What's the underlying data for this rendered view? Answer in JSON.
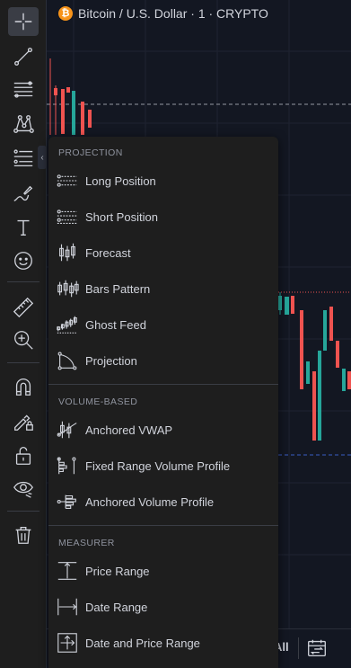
{
  "chart": {
    "symbol_title": "Bitcoin / U.S. Dollar · 1 · CRYPTO",
    "coin_glyph": "₿",
    "range_button": "All",
    "up_color": "#26a69a",
    "down_color": "#ef5350"
  },
  "toolbar": {
    "items": [
      {
        "name": "crosshair-icon",
        "active": true
      },
      {
        "name": "trend-line-icon"
      },
      {
        "name": "fib-retracement-icon"
      },
      {
        "name": "xabcd-pattern-icon"
      },
      {
        "name": "long-position-icon"
      },
      {
        "name": "brush-icon"
      },
      {
        "name": "text-icon"
      },
      {
        "name": "emoji-icon"
      },
      {
        "name": "ruler-icon"
      },
      {
        "name": "zoom-in-icon"
      },
      {
        "name": "magnet-icon"
      },
      {
        "name": "lock-drawing-icon"
      },
      {
        "name": "unlock-icon"
      },
      {
        "name": "eye-icon"
      },
      {
        "name": "trash-icon"
      }
    ]
  },
  "menu": {
    "sections": [
      {
        "title": "PROJECTION",
        "items": [
          {
            "label": "Long Position",
            "icon": "long-position-icon"
          },
          {
            "label": "Short Position",
            "icon": "short-position-icon"
          },
          {
            "label": "Forecast",
            "icon": "forecast-icon"
          },
          {
            "label": "Bars Pattern",
            "icon": "bars-pattern-icon"
          },
          {
            "label": "Ghost Feed",
            "icon": "ghost-feed-icon"
          },
          {
            "label": "Projection",
            "icon": "projection-icon"
          }
        ]
      },
      {
        "title": "VOLUME-BASED",
        "items": [
          {
            "label": "Anchored VWAP",
            "icon": "anchored-vwap-icon"
          },
          {
            "label": "Fixed Range Volume Profile",
            "icon": "fixed-range-volume-profile-icon"
          },
          {
            "label": "Anchored Volume Profile",
            "icon": "anchored-volume-profile-icon"
          }
        ]
      },
      {
        "title": "MEASURER",
        "items": [
          {
            "label": "Price Range",
            "icon": "price-range-icon"
          },
          {
            "label": "Date Range",
            "icon": "date-range-icon"
          },
          {
            "label": "Date and Price Range",
            "icon": "date-and-price-range-icon"
          }
        ]
      }
    ]
  }
}
